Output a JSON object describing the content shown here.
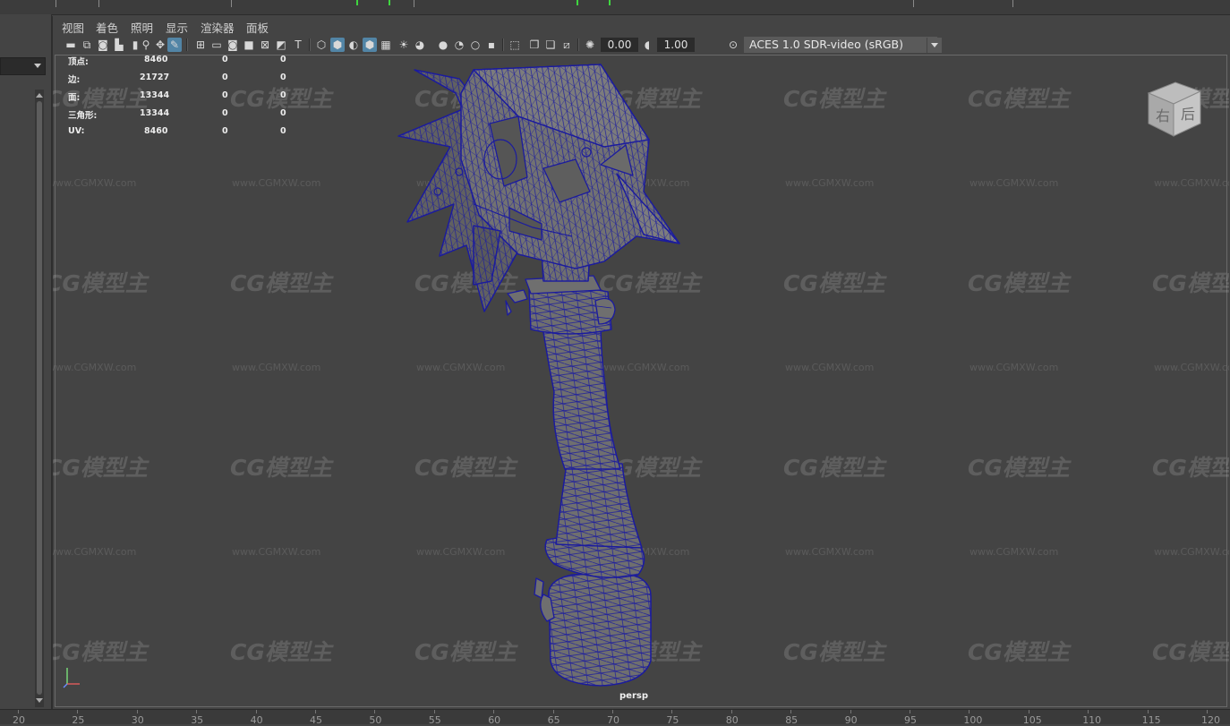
{
  "panel_menu": {
    "items": [
      "视图",
      "着色",
      "照明",
      "显示",
      "渲染器",
      "面板"
    ]
  },
  "toolbar": {
    "exposure_value": "0.00",
    "gamma_value": "1.00",
    "color_management_label": "ACES 1.0 SDR-video (sRGB)"
  },
  "hud": {
    "rows": [
      {
        "label": "顶点:",
        "values": [
          "8460",
          "0",
          "0"
        ]
      },
      {
        "label": "边:",
        "values": [
          "21727",
          "0",
          "0"
        ]
      },
      {
        "label": "面:",
        "values": [
          "13344",
          "0",
          "0"
        ]
      },
      {
        "label": "三角形:",
        "values": [
          "13344",
          "0",
          "0"
        ]
      },
      {
        "label": "UV:",
        "values": [
          "8460",
          "0",
          "0"
        ]
      }
    ]
  },
  "viewcube": {
    "right_face": "右",
    "back_face": "后"
  },
  "camera_label": "persp",
  "watermark": {
    "logo": "CG模型主",
    "url": "www.CGMXW.com"
  },
  "ruler": {
    "labels": [
      "20",
      "25",
      "30",
      "35",
      "40",
      "45",
      "50",
      "55",
      "60",
      "65",
      "70",
      "75",
      "80",
      "85",
      "90",
      "95",
      "100",
      "105",
      "110",
      "115",
      "120"
    ]
  },
  "colors": {
    "viewport_bg": "#444444",
    "wireframe": "#1b1b9e",
    "mesh_fill": "#6f6f6f",
    "active_icon": "#5285a6"
  }
}
